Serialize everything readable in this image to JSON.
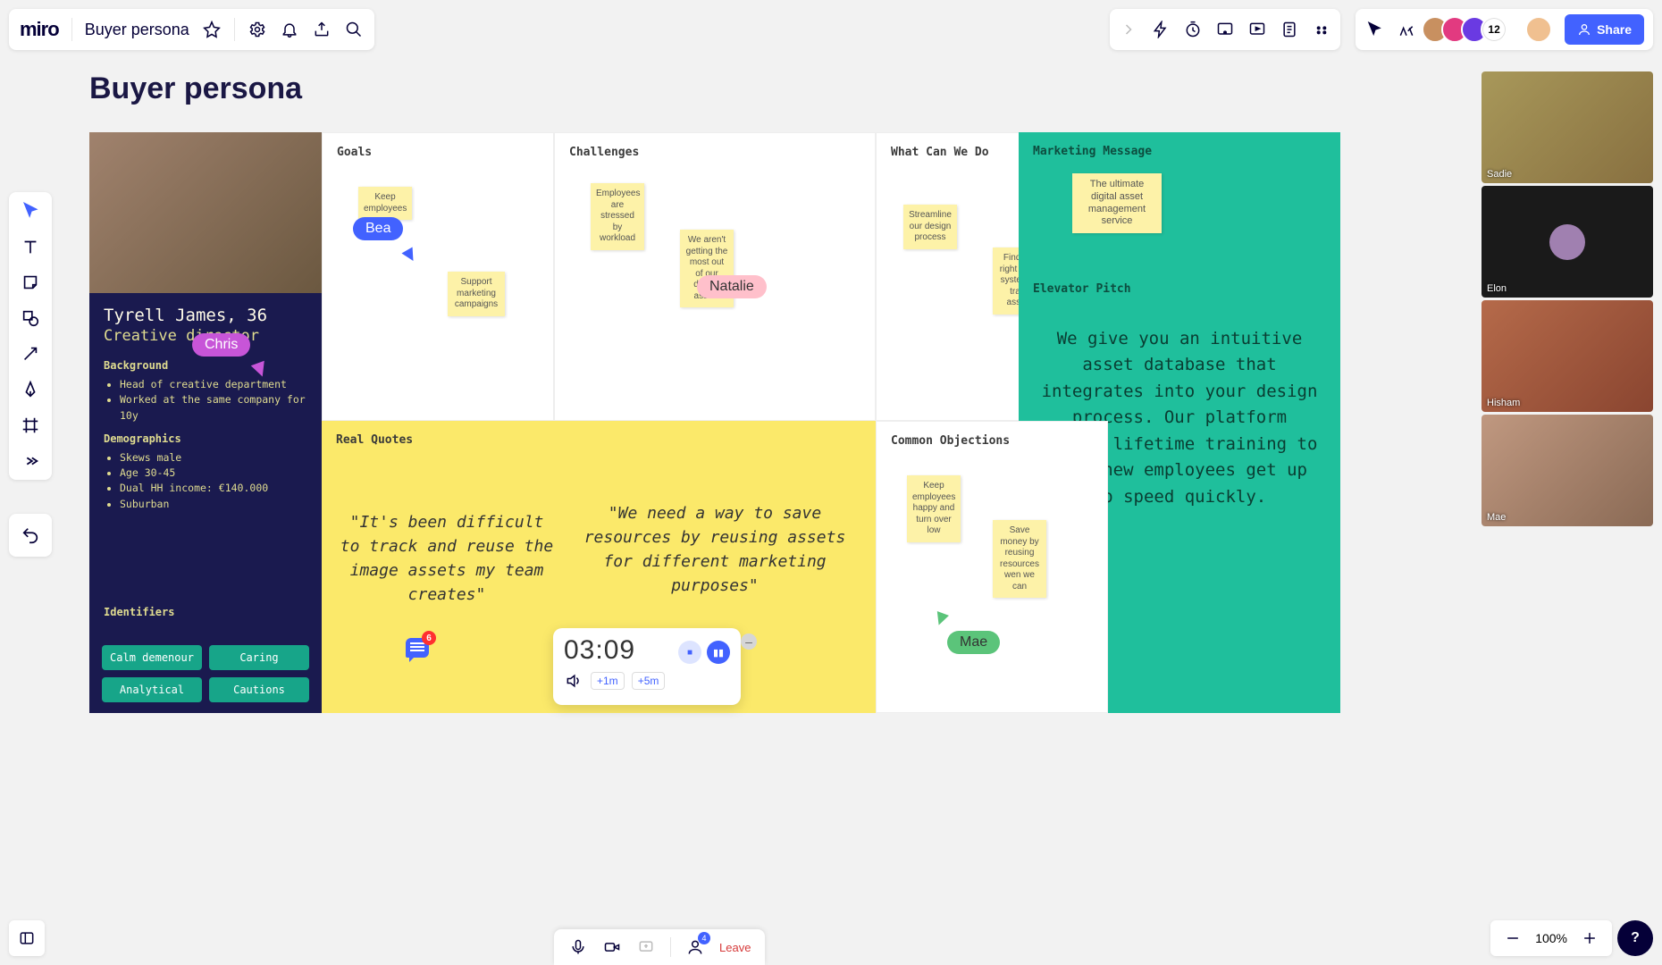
{
  "header": {
    "logo": "miro",
    "board_title": "Buyer persona",
    "share": "Share",
    "avatar_overflow": "12"
  },
  "page": {
    "title": "Buyer persona"
  },
  "persona": {
    "name_line": "Tyrell James, 36",
    "role": "Creative director",
    "bg_head": "Background",
    "bg_items": [
      "Head of creative department",
      "Worked at the same company for 10y"
    ],
    "demo_head": "Demographics",
    "demo_items": [
      "Skews male",
      "Age 30-45",
      "Dual HH income: €140.000",
      "Suburban"
    ],
    "id_head": "Identifiers",
    "tags": [
      "Calm demenour",
      "Caring",
      "Analytical",
      "Cautions"
    ]
  },
  "sections": {
    "goals": "Goals",
    "challenges": "Challenges",
    "what": "What Can We Do",
    "mm": "Marketing Message",
    "ep": "Elevator Pitch",
    "quotes": "Real Quotes",
    "obj": "Common Objections"
  },
  "stickies": {
    "keep_emp": "Keep employees",
    "support_mkt": "Support marketing campaigns",
    "stressed": "Employees are stressed by workload",
    "not_getting": "We aren't getting the most out of our design assets",
    "streamline": "Streamline our design process",
    "find_dam": "Find the right DAM system to track assets",
    "mm_msg": "The ultimate digital asset management service",
    "keep_happy": "Keep employees happy and turn over low",
    "save_money": "Save money by reusing resources wen we can"
  },
  "quotes": {
    "q1": "\"It's been difficult to track and reuse the image assets my team creates\"",
    "q2": "\"We need a way to save resources by reusing assets for different marketing purposes\""
  },
  "pitch": "We give you an intuitive asset database that integrates into your design process. Our platform offers lifetime training to help new employees get up to speed quickly.",
  "cursors": {
    "bea": "Bea",
    "chris": "Chris",
    "natalie": "Natalie",
    "mae": "Mae"
  },
  "comment_count": "6",
  "timer": {
    "time": "03:09",
    "plus1": "+1m",
    "plus5": "+5m"
  },
  "meetbar": {
    "leave": "Leave",
    "participant_badge": "4"
  },
  "videos": [
    "Sadie",
    "Elon",
    "Hisham",
    "Mae"
  ],
  "zoom": "100%"
}
